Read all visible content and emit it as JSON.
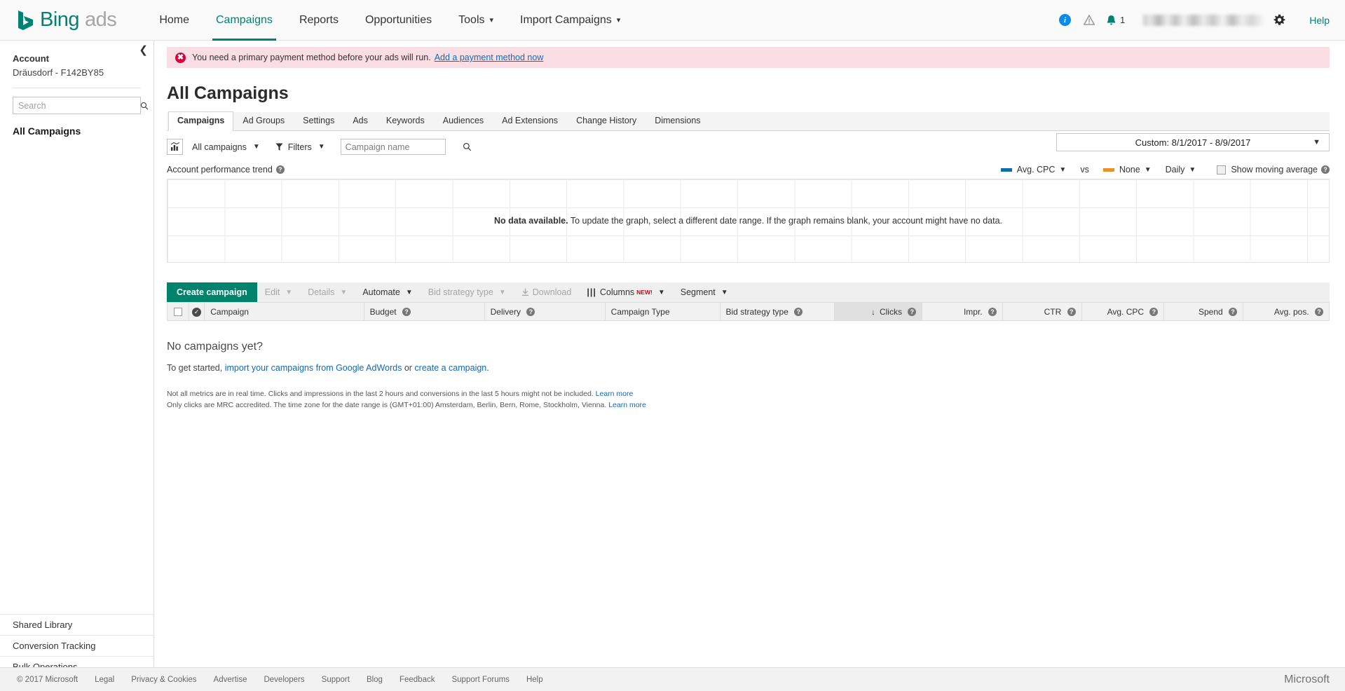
{
  "header": {
    "brand_bing": "Bing",
    "brand_ads": "ads",
    "nav": [
      {
        "label": "Home",
        "active": false,
        "caret": false
      },
      {
        "label": "Campaigns",
        "active": true,
        "caret": false
      },
      {
        "label": "Reports",
        "active": false,
        "caret": false
      },
      {
        "label": "Opportunities",
        "active": false,
        "caret": false
      },
      {
        "label": "Tools",
        "active": false,
        "caret": true
      },
      {
        "label": "Import Campaigns",
        "active": false,
        "caret": true
      }
    ],
    "notification_count": "1",
    "help_label": "Help",
    "icons": {
      "globe": "globe-info-icon",
      "warning": "warning-icon",
      "bell": "notification-bell-icon",
      "gear": "settings-gear-icon"
    }
  },
  "sidebar": {
    "account_label": "Account",
    "account_name": "Dräusdorf - F142BY85",
    "search_placeholder": "Search",
    "all_campaigns": "All Campaigns",
    "bottom_links": [
      {
        "label": "Shared Library"
      },
      {
        "label": "Conversion Tracking"
      },
      {
        "label": "Bulk Operations"
      }
    ]
  },
  "alert": {
    "message": "You need a primary payment method before your ads will run.",
    "link": "Add a payment method now"
  },
  "page": {
    "title": "All Campaigns",
    "date_range": "Custom: 8/1/2017 - 8/9/2017"
  },
  "tabs": [
    {
      "label": "Campaigns",
      "active": true
    },
    {
      "label": "Ad Groups",
      "active": false
    },
    {
      "label": "Settings",
      "active": false
    },
    {
      "label": "Ads",
      "active": false
    },
    {
      "label": "Keywords",
      "active": false
    },
    {
      "label": "Audiences",
      "active": false
    },
    {
      "label": "Ad Extensions",
      "active": false
    },
    {
      "label": "Change History",
      "active": false
    },
    {
      "label": "Dimensions",
      "active": false
    }
  ],
  "filter_row": {
    "scope_label": "All campaigns",
    "filters_label": "Filters",
    "name_search_placeholder": "Campaign name"
  },
  "chart": {
    "title": "Account performance trend",
    "legend": {
      "metric1": "Avg. CPC",
      "metric1_color": "#0c6fa8",
      "vs": "vs",
      "metric2": "None",
      "metric2_color": "#e8912a",
      "granularity": "Daily",
      "moving_average": "Show moving average",
      "moving_average_checked": false
    },
    "no_data_bold": "No data available.",
    "no_data_rest": "To update the graph, select a different date range. If the graph remains blank, your account might have no data."
  },
  "chart_data": {
    "type": "line",
    "title": "Account performance trend",
    "series": [
      {
        "name": "Avg. CPC",
        "color": "#0c6fa8",
        "values": []
      },
      {
        "name": "None",
        "color": "#e8912a",
        "values": []
      }
    ],
    "x": [],
    "xlabel": "",
    "ylabel": "",
    "grid": true,
    "legend_position": "top-right",
    "granularity": "Daily",
    "empty": true,
    "empty_message": "No data available. To update the graph, select a different date range. If the graph remains blank, your account might have no data."
  },
  "toolbar": {
    "create_campaign": "Create campaign",
    "items": [
      {
        "label": "Edit",
        "caret": true,
        "disabled": true
      },
      {
        "label": "Details",
        "caret": true,
        "disabled": true
      },
      {
        "label": "Automate",
        "caret": true,
        "disabled": false
      },
      {
        "label": "Bid strategy type",
        "caret": true,
        "disabled": true
      },
      {
        "label": "Download",
        "caret": false,
        "disabled": true,
        "icon": "download-icon"
      }
    ],
    "columns_label": "Columns",
    "columns_badge": "NEW!",
    "segment_label": "Segment"
  },
  "table": {
    "columns": [
      {
        "label": "Campaign",
        "align": "left",
        "help": false,
        "sorted": false
      },
      {
        "label": "Budget",
        "align": "left",
        "help": true,
        "sorted": false
      },
      {
        "label": "Delivery",
        "align": "left",
        "help": true,
        "sorted": false
      },
      {
        "label": "Campaign Type",
        "align": "left",
        "help": false,
        "sorted": false
      },
      {
        "label": "Bid strategy type",
        "align": "left",
        "help": true,
        "sorted": false
      },
      {
        "label": "Clicks",
        "align": "right",
        "help": true,
        "sorted": true
      },
      {
        "label": "Impr.",
        "align": "right",
        "help": true,
        "sorted": false
      },
      {
        "label": "CTR",
        "align": "right",
        "help": true,
        "sorted": false
      },
      {
        "label": "Avg. CPC",
        "align": "right",
        "help": true,
        "sorted": false
      },
      {
        "label": "Spend",
        "align": "right",
        "help": true,
        "sorted": false
      },
      {
        "label": "Avg. pos.",
        "align": "right",
        "help": true,
        "sorted": false
      }
    ],
    "rows": []
  },
  "empty_state": {
    "title": "No campaigns yet?",
    "prefix": "To get started, ",
    "link1": "import your campaigns from Google AdWords",
    "middle": " or ",
    "link2": "create a campaign",
    "suffix": "."
  },
  "footnotes": {
    "line1_text": "Not all metrics are in real time. Clicks and impressions in the last 2 hours and conversions in the last 5 hours might not be included.",
    "line1_link": "Learn more",
    "line2_text": "Only clicks are MRC accredited. The time zone for the date range is (GMT+01:00) Amsterdam, Berlin, Bern, Rome, Stockholm, Vienna.",
    "line2_link": "Learn more"
  },
  "footer": {
    "links": [
      {
        "label": "© 2017 Microsoft"
      },
      {
        "label": "Legal"
      },
      {
        "label": "Privacy & Cookies"
      },
      {
        "label": "Advertise"
      },
      {
        "label": "Developers"
      },
      {
        "label": "Support"
      },
      {
        "label": "Blog"
      },
      {
        "label": "Feedback"
      },
      {
        "label": "Support Forums"
      },
      {
        "label": "Help"
      }
    ],
    "logo": "Microsoft"
  }
}
